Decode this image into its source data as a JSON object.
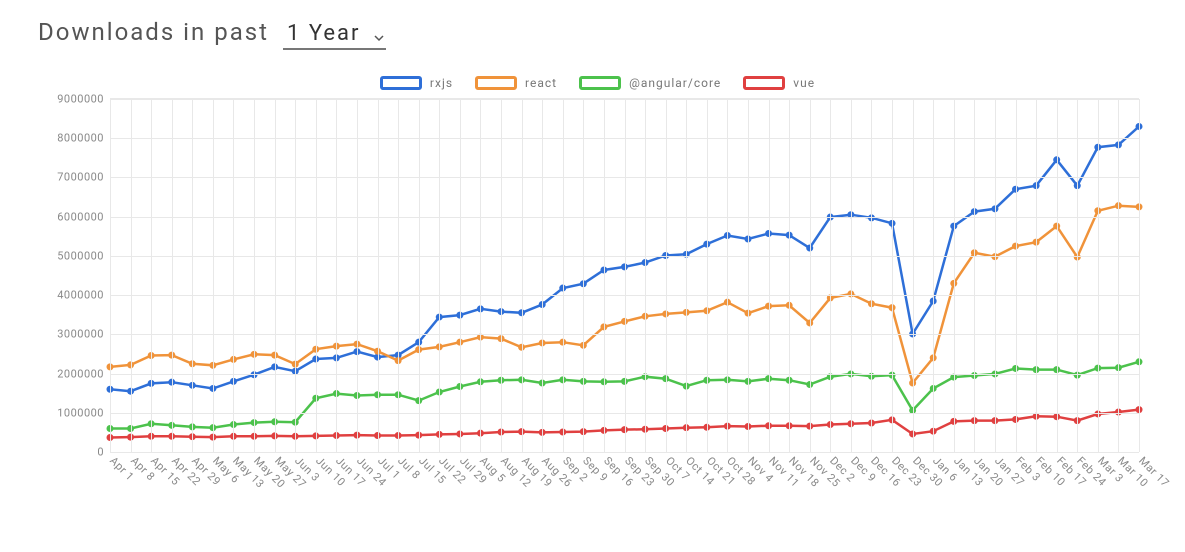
{
  "header": {
    "title_prefix": "Downloads in past",
    "period": "1 Year"
  },
  "legend": [
    {
      "key": "rxjs",
      "label": "rxjs",
      "color": "#2e6fd8"
    },
    {
      "key": "react",
      "label": "react",
      "color": "#f0933a"
    },
    {
      "key": "angular",
      "label": "@angular/core",
      "color": "#4cc24c"
    },
    {
      "key": "vue",
      "label": "vue",
      "color": "#e04040"
    }
  ],
  "chart_data": {
    "type": "line",
    "title": "Downloads in past 1 Year",
    "xlabel": "",
    "ylabel": "",
    "ylim": [
      0,
      9000000
    ],
    "yticks": [
      0,
      1000000,
      2000000,
      3000000,
      4000000,
      5000000,
      6000000,
      7000000,
      8000000,
      9000000
    ],
    "categories": [
      "Apr 1",
      "Apr 8",
      "Apr 15",
      "Apr 22",
      "Apr 29",
      "May 6",
      "May 13",
      "May 20",
      "May 27",
      "Jun 3",
      "Jun 10",
      "Jun 17",
      "Jun 24",
      "Jul 1",
      "Jul 8",
      "Jul 15",
      "Jul 22",
      "Jul 29",
      "Aug 5",
      "Aug 12",
      "Aug 19",
      "Aug 26",
      "Sep 2",
      "Sep 9",
      "Sep 16",
      "Sep 23",
      "Sep 30",
      "Oct 7",
      "Oct 14",
      "Oct 21",
      "Oct 28",
      "Nov 4",
      "Nov 11",
      "Nov 18",
      "Nov 25",
      "Dec 2",
      "Dec 9",
      "Dec 16",
      "Dec 23",
      "Dec 30",
      "Jan 6",
      "Jan 13",
      "Jan 20",
      "Jan 27",
      "Feb 3",
      "Feb 10",
      "Feb 17",
      "Feb 24",
      "Mar 3",
      "Mar 10",
      "Mar 17"
    ],
    "series": [
      {
        "name": "rxjs",
        "color": "#2e6fd8",
        "values": [
          1600000,
          1550000,
          1750000,
          1780000,
          1700000,
          1620000,
          1800000,
          1970000,
          2170000,
          2060000,
          2370000,
          2400000,
          2560000,
          2420000,
          2470000,
          2800000,
          3440000,
          3490000,
          3650000,
          3580000,
          3550000,
          3760000,
          4180000,
          4290000,
          4640000,
          4720000,
          4830000,
          5010000,
          5040000,
          5300000,
          5520000,
          5430000,
          5570000,
          5530000,
          5200000,
          5990000,
          6050000,
          5970000,
          5830000,
          3010000,
          3850000,
          5760000,
          6130000,
          6200000,
          6700000,
          6790000,
          7450000,
          6790000,
          7770000,
          7830000,
          8300000
        ]
      },
      {
        "name": "react",
        "color": "#f0933a",
        "values": [
          2170000,
          2220000,
          2460000,
          2470000,
          2250000,
          2210000,
          2360000,
          2490000,
          2470000,
          2240000,
          2620000,
          2700000,
          2750000,
          2570000,
          2330000,
          2610000,
          2680000,
          2800000,
          2930000,
          2890000,
          2670000,
          2780000,
          2800000,
          2720000,
          3190000,
          3330000,
          3460000,
          3520000,
          3560000,
          3600000,
          3820000,
          3540000,
          3720000,
          3740000,
          3290000,
          3930000,
          4030000,
          3780000,
          3680000,
          1760000,
          2400000,
          4300000,
          5080000,
          4980000,
          5250000,
          5350000,
          5760000,
          4970000,
          6150000,
          6280000,
          6250000
        ]
      },
      {
        "name": "@angular/core",
        "color": "#4cc24c",
        "values": [
          600000,
          600000,
          720000,
          680000,
          640000,
          620000,
          700000,
          750000,
          770000,
          760000,
          1370000,
          1490000,
          1440000,
          1460000,
          1460000,
          1310000,
          1530000,
          1670000,
          1790000,
          1830000,
          1840000,
          1760000,
          1840000,
          1800000,
          1790000,
          1800000,
          1920000,
          1870000,
          1680000,
          1830000,
          1840000,
          1800000,
          1870000,
          1830000,
          1720000,
          1920000,
          1990000,
          1930000,
          1960000,
          1060000,
          1620000,
          1910000,
          1950000,
          1990000,
          2130000,
          2100000,
          2100000,
          1960000,
          2140000,
          2150000,
          2300000
        ]
      },
      {
        "name": "vue",
        "color": "#e04040",
        "values": [
          370000,
          380000,
          400000,
          400000,
          390000,
          380000,
          400000,
          400000,
          410000,
          400000,
          410000,
          420000,
          430000,
          420000,
          420000,
          430000,
          450000,
          460000,
          480000,
          510000,
          520000,
          500000,
          510000,
          520000,
          550000,
          570000,
          580000,
          600000,
          620000,
          630000,
          660000,
          650000,
          670000,
          670000,
          660000,
          700000,
          720000,
          740000,
          820000,
          460000,
          530000,
          780000,
          800000,
          800000,
          830000,
          910000,
          900000,
          800000,
          970000,
          1020000,
          1080000
        ]
      }
    ]
  }
}
